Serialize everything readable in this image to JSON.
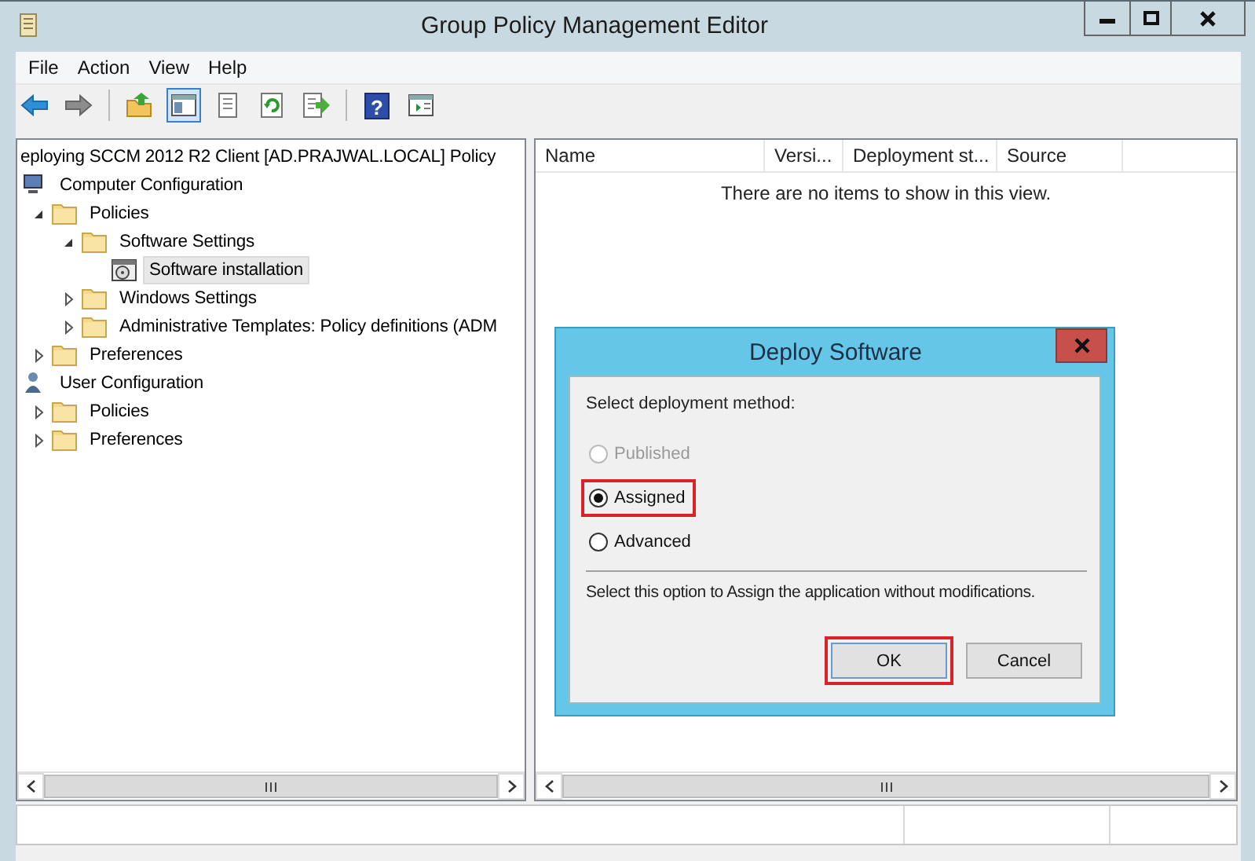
{
  "window": {
    "title": "Group Policy Management Editor"
  },
  "menu": [
    "File",
    "Action",
    "View",
    "Help"
  ],
  "toolbar": [
    {
      "kind": "back",
      "pressed": false
    },
    {
      "kind": "forward",
      "pressed": false
    },
    {
      "kind": "separator"
    },
    {
      "kind": "up",
      "pressed": false
    },
    {
      "kind": "tree",
      "pressed": true
    },
    {
      "kind": "list",
      "pressed": false
    },
    {
      "kind": "refresh",
      "pressed": false
    },
    {
      "kind": "export",
      "pressed": false
    },
    {
      "kind": "separator"
    },
    {
      "kind": "help",
      "pressed": false,
      "glyph": "?"
    },
    {
      "kind": "console",
      "pressed": false
    }
  ],
  "tree": {
    "root": "eploying SCCM 2012 R2 Client [AD.PRAJWAL.LOCAL] Policy",
    "items": [
      {
        "label": "Computer Configuration",
        "kind": "computer",
        "selected": false,
        "children": [
          {
            "label": "Policies",
            "kind": "folder",
            "expanded": true,
            "selected": false,
            "children": [
              {
                "label": "Software Settings",
                "kind": "folder",
                "expanded": true,
                "selected": false,
                "children": [
                  {
                    "label": "Software installation",
                    "kind": "package",
                    "selected": true
                  }
                ]
              },
              {
                "label": "Windows Settings",
                "kind": "folder",
                "expanded": false,
                "selected": false
              },
              {
                "label": "Administrative Templates: Policy definitions (ADM",
                "kind": "folder",
                "expanded": false,
                "selected": false
              }
            ]
          },
          {
            "label": "Preferences",
            "kind": "folder",
            "expanded": false,
            "selected": false
          }
        ]
      },
      {
        "label": "User Configuration",
        "kind": "user",
        "selected": false,
        "children": [
          {
            "label": "Policies",
            "kind": "folder",
            "expanded": false,
            "selected": false
          },
          {
            "label": "Preferences",
            "kind": "folder",
            "expanded": false,
            "selected": false
          }
        ]
      }
    ]
  },
  "list": {
    "columns": [
      "Name",
      "Versi...",
      "Deployment st...",
      "Source"
    ],
    "empty_message": "There are no items to show in this view."
  },
  "dialog": {
    "title": "Deploy Software",
    "prompt": "Select deployment method:",
    "options": [
      {
        "label": "Published",
        "selected": false,
        "disabled": true,
        "highlighted": false
      },
      {
        "label": "Assigned",
        "selected": true,
        "disabled": false,
        "highlighted": true
      },
      {
        "label": "Advanced",
        "selected": false,
        "disabled": false,
        "highlighted": false
      }
    ],
    "description": "Select this option to Assign the application without modifications.",
    "buttons": [
      {
        "label": "OK",
        "default": true,
        "highlighted": true
      },
      {
        "label": "Cancel",
        "default": false,
        "highlighted": false
      }
    ]
  }
}
